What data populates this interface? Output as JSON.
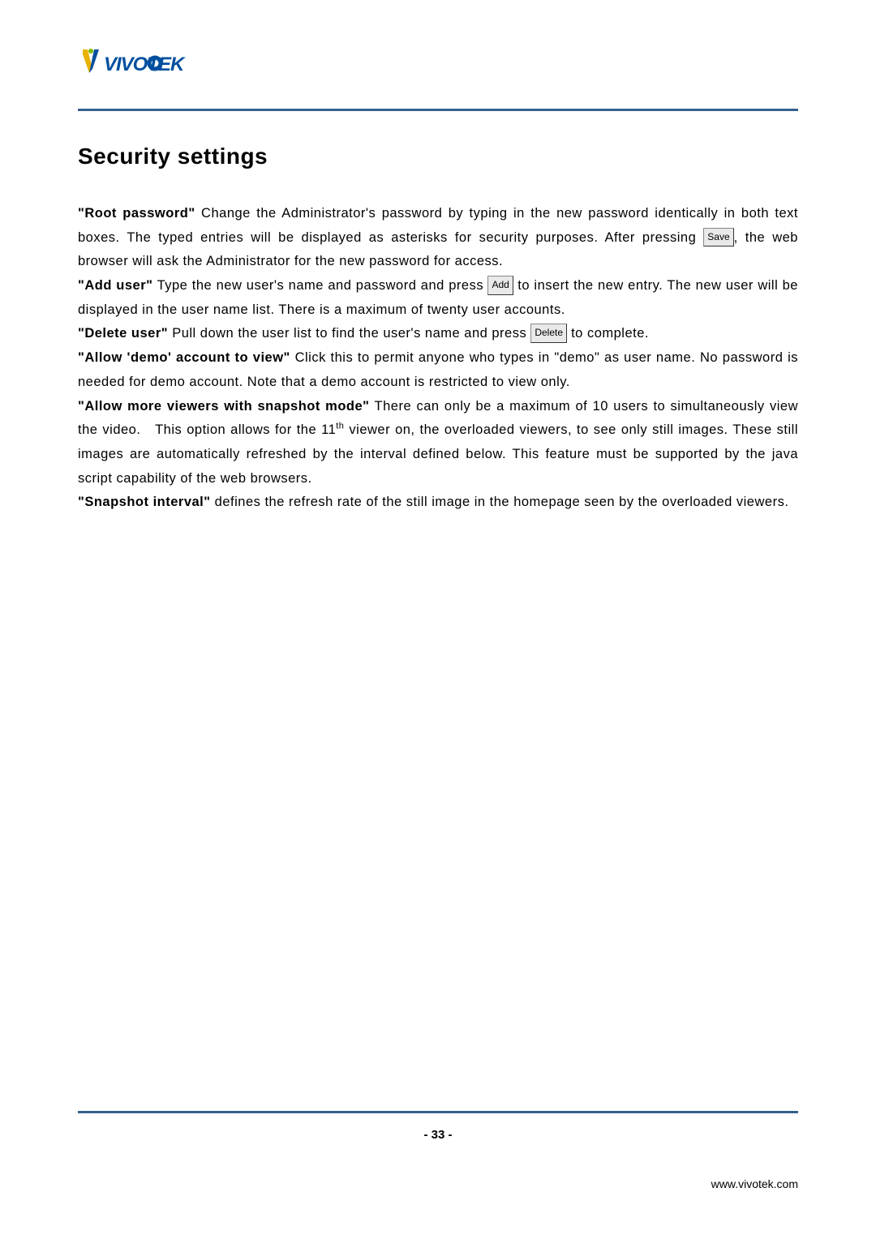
{
  "brand": "VIVOTEK",
  "heading": "Security settings",
  "buttons": {
    "save": "Save",
    "add": "Add",
    "delete": "Delete"
  },
  "paragraphs": {
    "root_password": {
      "label": "\"Root password\"",
      "text_before": " Change the Administrator's password by typing in the new password identically in both text boxes. The typed entries will be displayed as asterisks for security purposes. After pressing ",
      "text_after": ", the web browser will ask the Administrator for the new password for access."
    },
    "add_user": {
      "label": "\"Add user\"",
      "text_before": " Type the new user's name and password and press ",
      "text_after": " to insert the new entry. The new user will be displayed in the user name list. There is a maximum of twenty user accounts."
    },
    "delete_user": {
      "label": "\"Delete user\"",
      "text_before": " Pull down the user list to find the user's name and press ",
      "text_after": " to complete."
    },
    "allow_demo": {
      "label": "\"Allow 'demo' account to view\"",
      "text": " Click this to permit anyone who types in \"demo\" as user name. No password is needed for demo account. Note that a demo account is restricted to view only."
    },
    "allow_more_viewers": {
      "label": "\"Allow more viewers with snapshot mode\"",
      "text_before": " There can only be a maximum of 10 users to simultaneously view the video.   This option allows for the 11",
      "sup": "th",
      "text_after": " viewer on, the overloaded viewers, to see only still images. These still images are automatically refreshed by the interval defined below. This feature must be supported by the java script capability of the web browsers."
    },
    "snapshot_interval": {
      "label": "\"Snapshot interval\"",
      "text": " defines the refresh rate of the still image in the homepage seen by the overloaded viewers."
    }
  },
  "page_number": "- 33 -",
  "footer_url": "www.vivotek.com"
}
